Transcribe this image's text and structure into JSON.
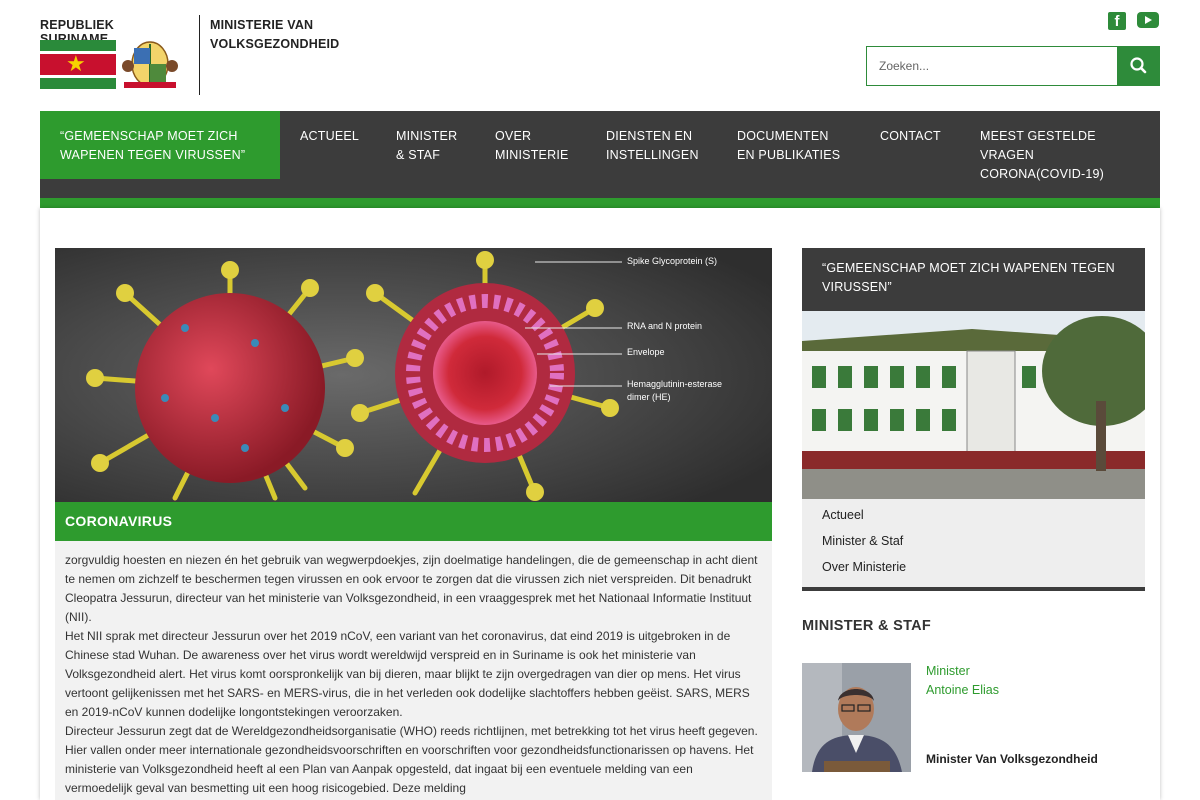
{
  "header": {
    "republic": "REPUBLIEK SURINAME",
    "ministry_line1": "MINISTERIE VAN",
    "ministry_line2": "VOLKSGEZONDHEID",
    "social": [
      "facebook-icon",
      "youtube-icon"
    ],
    "search_placeholder": "Zoeken..."
  },
  "nav": {
    "items": [
      {
        "line1": "“GEMEENSCHAP MOET ZICH",
        "line2": "WAPENEN TEGEN VIRUSSEN”",
        "line3": ""
      },
      {
        "line1": "ACTUEEL",
        "line2": "",
        "line3": ""
      },
      {
        "line1": "MINISTER",
        "line2": "& STAF",
        "line3": ""
      },
      {
        "line1": "OVER",
        "line2": "MINISTERIE",
        "line3": ""
      },
      {
        "line1": "DIENSTEN EN",
        "line2": "INSTELLINGEN",
        "line3": ""
      },
      {
        "line1": "DOCUMENTEN",
        "line2": "EN PUBLIKATIES",
        "line3": ""
      },
      {
        "line1": "CONTACT",
        "line2": "",
        "line3": ""
      },
      {
        "line1": "MEEST GESTELDE",
        "line2": "VRAGEN",
        "line3": "CORONA(COVID-19)"
      }
    ]
  },
  "hero": {
    "labels": [
      "Spike Glycoprotein (S)",
      "RNA and N protein",
      "Envelope",
      "Hemagglutinin-esterase",
      "dimer (HE)"
    ]
  },
  "article": {
    "title": "CORONAVIRUS",
    "paragraphs": [
      "zorgvuldig hoesten en niezen én het gebruik van wegwerpdoekjes, zijn doelmatige handelingen, die de gemeenschap in acht dient te nemen om zichzelf te beschermen tegen virussen en ook ervoor te zorgen dat die virussen zich niet verspreiden. Dit benadrukt Cleopatra Jessurun, directeur van het ministerie van Volksgezondheid, in een vraaggesprek met het Nationaal Informatie Instituut (NII).",
      "Het NII sprak met directeur Jessurun over het 2019 nCoV, een variant van het coronavirus, dat eind 2019 is uitgebroken in de Chinese stad Wuhan. De awareness over het virus wordt wereldwijd verspreid en in Suriname is ook het ministerie van Volksgezondheid alert. Het virus komt oorspronkelijk van bij dieren, maar blijkt te zijn overgedragen van dier op mens. Het virus vertoont gelijkenissen met het SARS- en MERS-virus, die in het verleden ook dodelijke slachtoffers hebben geëist. SARS, MERS en 2019-nCoV kunnen dodelijke longontstekingen veroorzaken.",
      "Directeur Jessurun zegt dat de Wereldgezondheidsorganisatie (WHO) reeds richtlijnen, met betrekking tot het virus heeft gegeven. Hier vallen onder meer internationale gezondheidsvoorschriften en voorschriften voor gezondheidsfunctionarissen op havens. Het ministerie van Volksgezondheid heeft al een Plan van Aanpak opgesteld, dat ingaat bij een eventuele melding van een vermoedelijk geval van besmetting uit een hoog risicogebied. Deze melding"
    ]
  },
  "sidebar": {
    "heading": "“GEMEENSCHAP MOET ZICH WAPENEN TEGEN VIRUSSEN”",
    "links": [
      "Actueel",
      "Minister & Staf",
      "Over Ministerie"
    ],
    "section_title": "MINISTER & STAF",
    "minister_role": "Minister",
    "minister_name": "Antoine Elias",
    "minister_caption": "Minister Van Volksgezondheid"
  },
  "colors": {
    "brand_green": "#2e9b2e",
    "nav_dark": "#3c3c3c"
  }
}
